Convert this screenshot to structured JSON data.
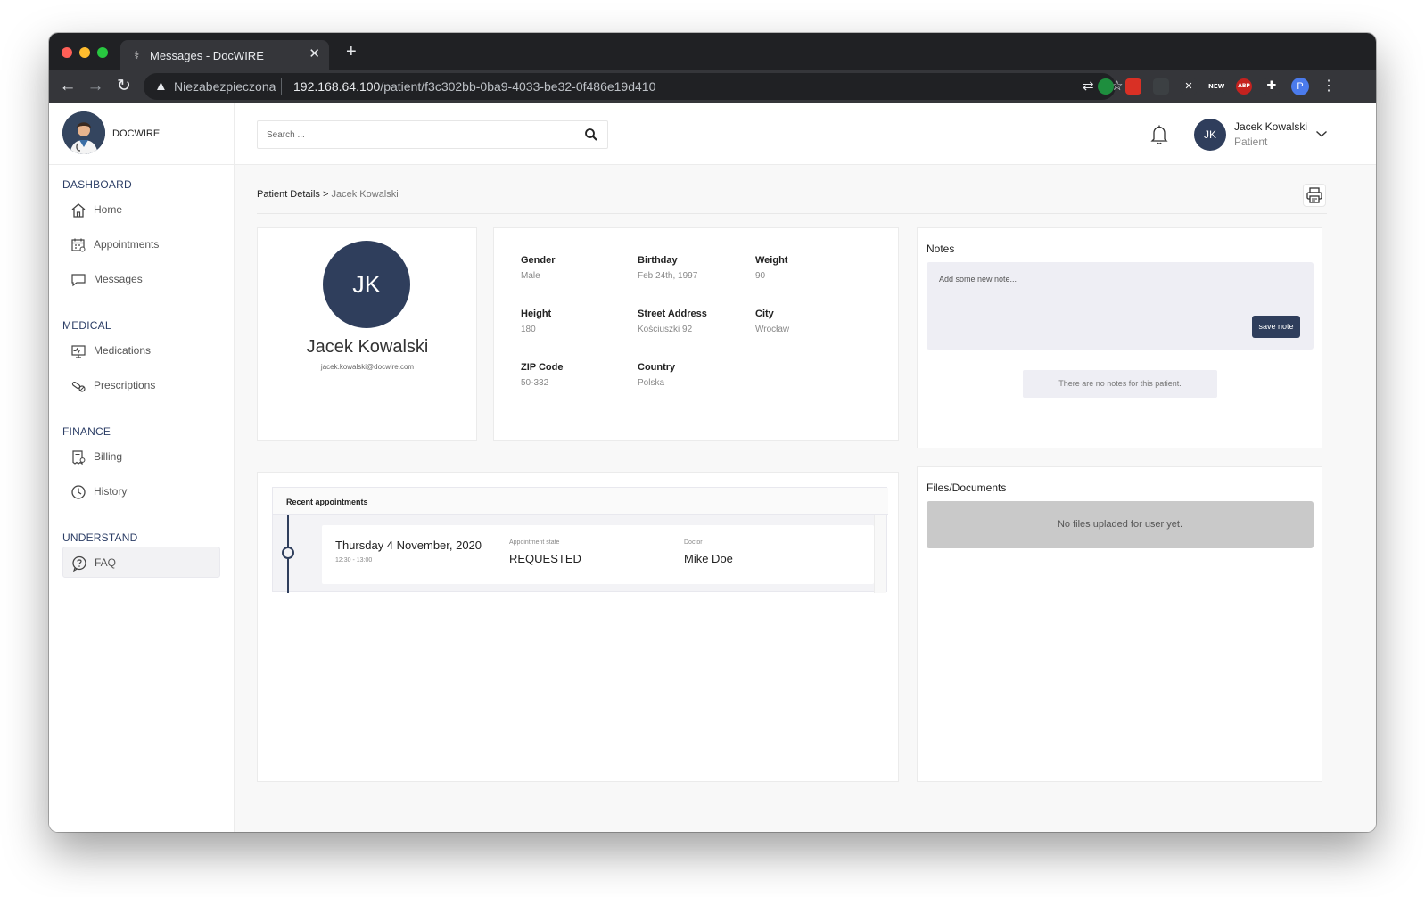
{
  "browser": {
    "tab_title": "Messages - DocWIRE",
    "tab_close": "✕",
    "new_tab": "+",
    "insecure_label": "Niezabezpieczona",
    "url_host": "192.168.64.100",
    "url_path": "/patient/f3c302bb-0ba9-4033-be32-0f486e19d410",
    "profile_initial": "P",
    "ext_new": "NEW",
    "ext_abp": "ABP"
  },
  "brand": {
    "name": "DOCWIRE"
  },
  "sidebar": {
    "sections": [
      {
        "title": "DASHBOARD",
        "items": [
          {
            "label": "Home"
          },
          {
            "label": "Appointments"
          },
          {
            "label": "Messages"
          }
        ]
      },
      {
        "title": "MEDICAL",
        "items": [
          {
            "label": "Medications"
          },
          {
            "label": "Prescriptions"
          }
        ]
      },
      {
        "title": "FINANCE",
        "items": [
          {
            "label": "Billing"
          },
          {
            "label": "History"
          }
        ]
      },
      {
        "title": "UNDERSTAND",
        "items": [
          {
            "label": "FAQ"
          }
        ]
      }
    ]
  },
  "search": {
    "placeholder": "Search ..."
  },
  "user": {
    "initials": "JK",
    "name": "Jacek Kowalski",
    "role": "Patient"
  },
  "breadcrumb": {
    "parent": "Patient Details",
    "separator": ">",
    "current": "Jacek Kowalski"
  },
  "profile": {
    "initials": "JK",
    "name": "Jacek Kowalski",
    "email": "jacek.kowalski@docwire.com"
  },
  "details": [
    {
      "label": "Gender",
      "value": "Male"
    },
    {
      "label": "Birthday",
      "value": "Feb 24th, 1997"
    },
    {
      "label": "Weight",
      "value": "90"
    },
    {
      "label": "Height",
      "value": "180"
    },
    {
      "label": "Street Address",
      "value": "Kościuszki 92"
    },
    {
      "label": "City",
      "value": "Wrocław"
    },
    {
      "label": "ZIP Code",
      "value": "50-332"
    },
    {
      "label": "Country",
      "value": "Polska"
    }
  ],
  "notes": {
    "title": "Notes",
    "placeholder": "Add some new note...",
    "save_label": "save note",
    "empty_text": "There are no notes for this patient."
  },
  "files": {
    "title": "Files/Documents",
    "empty_text": "No files upladed for user yet."
  },
  "appointments": {
    "title": "Recent appointments",
    "items": [
      {
        "date": "Thursday 4 November, 2020",
        "time": "12:30 - 13:00",
        "state_label": "Appointment state",
        "state": "REQUESTED",
        "doctor_label": "Doctor",
        "doctor": "Mike Doe"
      }
    ]
  },
  "colors": {
    "accent": "#2f3e5c",
    "section_heading": "#2c3e66"
  }
}
